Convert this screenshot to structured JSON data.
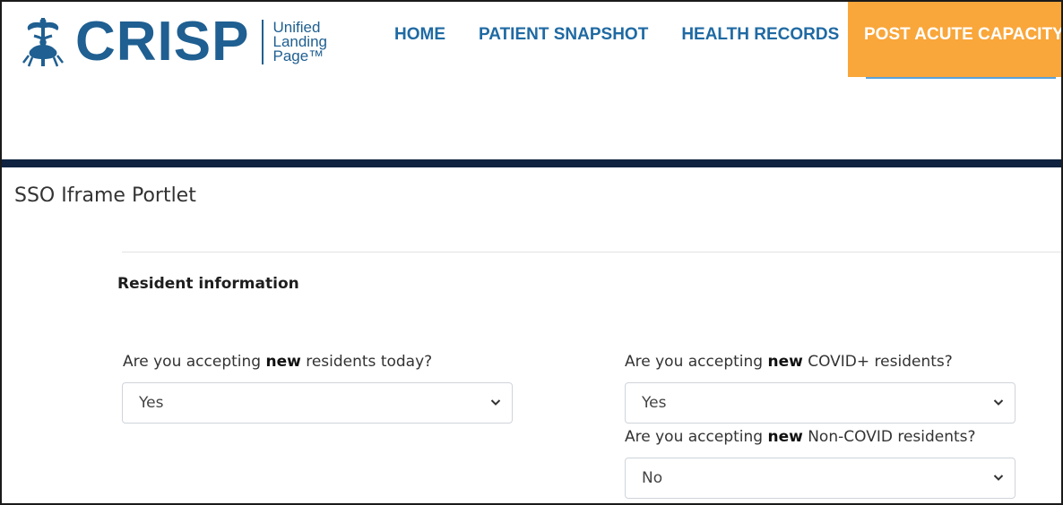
{
  "brand": {
    "wordmark": "CRISP",
    "sub_line1": "Unified",
    "sub_line2": "Landing",
    "sub_line3": "Page™",
    "color": "#1f5f91"
  },
  "nav": {
    "home": "HOME",
    "patient_snapshot": "PATIENT SNAPSHOT",
    "health_records": "HEALTH RECORDS",
    "post_acute_capacity": "POST ACUTE CAPACITY",
    "active_color": "#f9a63a"
  },
  "portlet": {
    "title": "SSO Iframe Portlet",
    "section_title": "Resident information"
  },
  "questions": [
    {
      "prefix": "Are you accepting ",
      "emphasis": "new",
      "suffix": " residents today?",
      "value": "Yes"
    },
    {
      "prefix": "Are you accepting ",
      "emphasis": "new",
      "suffix": " COVID+ residents?",
      "value": "Yes"
    },
    {
      "prefix": "Are you accepting ",
      "emphasis": "new",
      "suffix": " Non-COVID residents?",
      "value": "No"
    }
  ],
  "icons": {
    "logo_emblem": "caduceus-crab-icon",
    "select_chevron": "chevron-down-icon"
  }
}
